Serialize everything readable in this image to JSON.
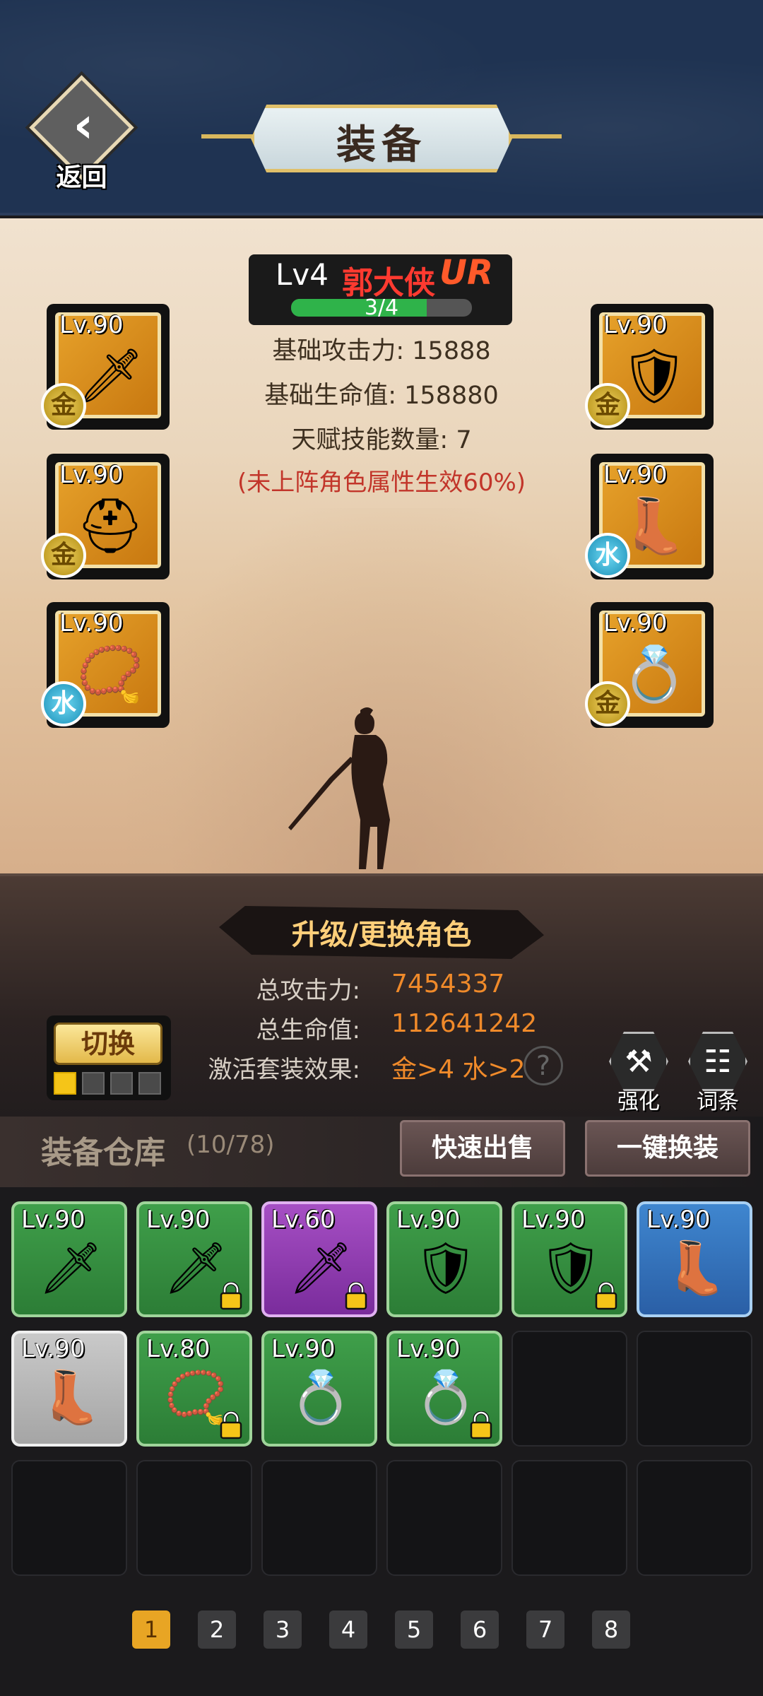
{
  "header": {
    "back_label": "返回",
    "title": "装备"
  },
  "hero": {
    "level": "Lv4",
    "name": "郭大侠",
    "rarity": "UR",
    "exp_text": "3/4",
    "exp_fraction": 0.75
  },
  "base_stats": [
    "基础攻击力: 15888",
    "基础生命值: 158880",
    "天赋技能数量: 7"
  ],
  "base_note": "(未上阵角色属性生效60%)",
  "equipped": [
    {
      "lv": "Lv.90",
      "element": "金",
      "icon": "sword-icon"
    },
    {
      "lv": "Lv.90",
      "element": "金",
      "icon": "helmet-icon"
    },
    {
      "lv": "Lv.90",
      "element": "水",
      "icon": "necklace-icon"
    },
    {
      "lv": "Lv.90",
      "element": "金",
      "icon": "armor-icon"
    },
    {
      "lv": "Lv.90",
      "element": "水",
      "icon": "boots-icon"
    },
    {
      "lv": "Lv.90",
      "element": "金",
      "icon": "ring-icon"
    }
  ],
  "upgrade_label": "升级/更换角色",
  "totals": {
    "attack_label": "总攻击力:",
    "attack_value": "7454337",
    "hp_label": "总生命值:",
    "hp_value": "112641242",
    "set_label": "激活套装效果:",
    "set_value": "金>4 水>2",
    "help": "?"
  },
  "switch": {
    "label": "切换",
    "slots": 4,
    "active_slot": 0
  },
  "tools": {
    "enhance_label": "强化",
    "affix_label": "词条"
  },
  "warehouse": {
    "title": "装备仓库",
    "count": "(10/78)",
    "quick_sell": "快速出售",
    "one_click_equip": "一键换装",
    "items": [
      {
        "lv": "Lv.90",
        "rarity": "green",
        "icon": "sword-icon",
        "locked": false
      },
      {
        "lv": "Lv.90",
        "rarity": "green",
        "icon": "sword-icon",
        "locked": true
      },
      {
        "lv": "Lv.60",
        "rarity": "purple",
        "icon": "sword-icon",
        "locked": true
      },
      {
        "lv": "Lv.90",
        "rarity": "green",
        "icon": "armor-icon",
        "locked": false
      },
      {
        "lv": "Lv.90",
        "rarity": "green",
        "icon": "armor-icon",
        "locked": true
      },
      {
        "lv": "Lv.90",
        "rarity": "blue",
        "icon": "boots-icon",
        "locked": false
      },
      {
        "lv": "Lv.90",
        "rarity": "gray",
        "icon": "boots-icon",
        "locked": false
      },
      {
        "lv": "Lv.80",
        "rarity": "green",
        "icon": "necklace-icon",
        "locked": true
      },
      {
        "lv": "Lv.90",
        "rarity": "green",
        "icon": "ring-icon",
        "locked": false
      },
      {
        "lv": "Lv.90",
        "rarity": "green",
        "icon": "ring-icon",
        "locked": true
      }
    ],
    "total_cells": 18
  },
  "pagination": {
    "pages": [
      "1",
      "2",
      "3",
      "4",
      "5",
      "6",
      "7",
      "8"
    ],
    "active": "1"
  },
  "colors": {
    "accent": "#e8a524",
    "gold_element": "#d4af37",
    "water_element": "#2aa6d1",
    "attack_value": "#f08a2a"
  }
}
